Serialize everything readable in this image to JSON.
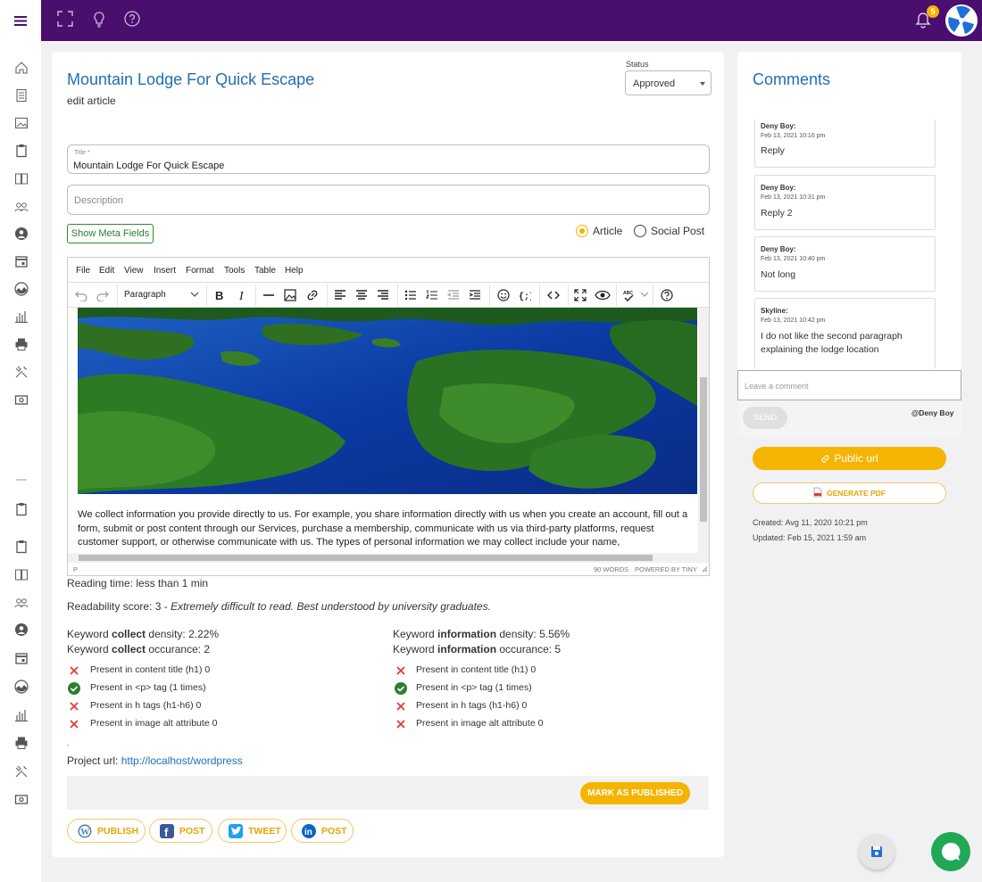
{
  "article": {
    "title": "Mountain Lodge For Quick Escape",
    "subtitle": "edit article"
  },
  "status": {
    "label": "Status",
    "value": "Approved"
  },
  "fields": {
    "title_label": "Title *",
    "title_value": "Mountain Lodge For Quick Escape",
    "description_placeholder": "Description"
  },
  "meta_button": "Show Meta Fields",
  "post_type": {
    "options": [
      "Article",
      "Social Post"
    ],
    "selected": "Article"
  },
  "editor": {
    "menu": [
      "File",
      "Edit",
      "View",
      "Insert",
      "Format",
      "Tools",
      "Table",
      "Help"
    ],
    "block_format": "Paragraph",
    "content": "We collect information you provide directly to us. For example, you share information directly with us when you create an account, fill out a form, submit or post content through our Services, purchase a membership, communicate with us via third-party platforms, request customer support, or otherwise communicate with us. The types of personal information we may collect include your name,",
    "path": "P",
    "word_count": "90 WORDS",
    "powered": "POWERED BY TINY"
  },
  "stats": {
    "reading_time": "Reading time: less than 1 min",
    "readability_prefix": "Readability score: 3 - ",
    "readability_note": "Extremely difficult to read. Best understood by university graduates."
  },
  "keywords": [
    {
      "word": "collect",
      "density_label": "density: 2.22%",
      "occurance_label": "occurance: 2",
      "checks": [
        {
          "text": "Present in content title (h1) 0",
          "ok": false
        },
        {
          "text": "Present in <p> tag (1 times)",
          "ok": true
        },
        {
          "text": "Present in h tags (h1-h6) 0",
          "ok": false
        },
        {
          "text": "Present in image alt attribute 0",
          "ok": false
        }
      ]
    },
    {
      "word": "information",
      "density_label": "density: 5.56%",
      "occurance_label": "occurance: 5",
      "checks": [
        {
          "text": "Present in content title (h1) 0",
          "ok": false
        },
        {
          "text": "Present in <p> tag (1 times)",
          "ok": true
        },
        {
          "text": "Present in h tags (h1-h6) 0",
          "ok": false
        },
        {
          "text": "Present in image alt attribute 0",
          "ok": false
        }
      ]
    }
  ],
  "keyword_prefix": "Keyword",
  "dot": ".",
  "project": {
    "label": "Project url: ",
    "url": "http://localhost/wordpress"
  },
  "mark_published": "MARK AS PUBLISHED",
  "social_buttons": [
    "PUBLISH",
    "POST",
    "TWEET",
    "POST"
  ],
  "notifications": {
    "count": "5"
  },
  "comments": {
    "title": "Comments",
    "items": [
      {
        "author": "Deny Boy:",
        "date": "Feb 13, 2021 10:16 pm",
        "text": "Reply"
      },
      {
        "author": "Deny Boy:",
        "date": "Feb 13, 2021 10:31 pm",
        "text": "Reply 2"
      },
      {
        "author": "Deny Boy:",
        "date": "Feb 13, 2021 10:40 pm",
        "text": "Not long"
      },
      {
        "author": "Skyline:",
        "date": "Feb 13, 2021 10:42 pm",
        "text": "I do not like the second paragraph explaining the lodge location"
      }
    ],
    "placeholder": "Leave a comment",
    "send": "SEND",
    "mention": "@Deny Boy"
  },
  "public_url": "Public url",
  "generate_pdf": "GENERATE PDF",
  "created": "Created: Avg 11, 2020 10:21 pm",
  "updated": "Updated: Feb 15, 2021 1:59 am",
  "colors": {
    "topbar": "#4a0e6f",
    "accent": "#f5b400",
    "link": "#1f6fb5",
    "success": "#2e7d32",
    "error": "#e53935",
    "chat": "#21a857"
  }
}
